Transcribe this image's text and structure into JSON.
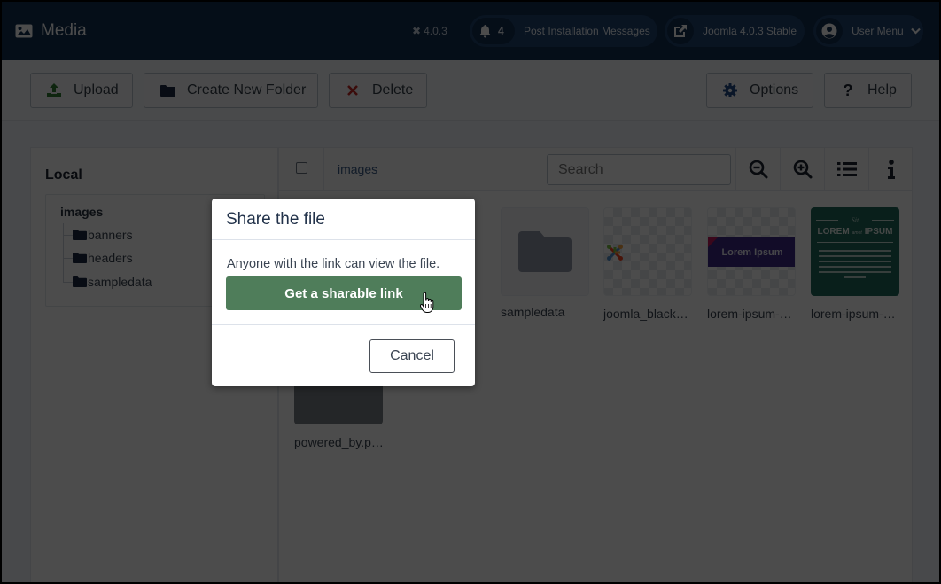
{
  "header": {
    "title": "Media",
    "version": "4.0.3",
    "notifications": {
      "count": "4",
      "label": "Post Installation Messages"
    },
    "site_link": "Joomla 4.0.3 Stable",
    "user_menu": "User Menu"
  },
  "toolbar": {
    "upload": "Upload",
    "create_folder": "Create New Folder",
    "delete": "Delete",
    "options": "Options",
    "help": "Help"
  },
  "sidebar": {
    "heading": "Local",
    "root": "images",
    "folders": [
      "banners",
      "headers",
      "sampledata"
    ]
  },
  "browser": {
    "breadcrumb": "images",
    "search_placeholder": "Search",
    "items": [
      {
        "name": "sampledata",
        "type": "folder"
      },
      {
        "name": "joomla_black…",
        "type": "image"
      },
      {
        "name": "lorem-ipsum-…",
        "type": "image"
      },
      {
        "name": "lorem-ipsum-…",
        "type": "image"
      },
      {
        "name": "powered_by.p…",
        "type": "image"
      }
    ],
    "thumb_text": {
      "banner": "Lorem Ipsum",
      "poster_small": "Sit",
      "poster_left": "LOREM",
      "poster_mid": "amet",
      "poster_right": "IPSUM"
    }
  },
  "modal": {
    "title": "Share the file",
    "description": "Anyone with the link can view the file.",
    "share_button": "Get a sharable link",
    "cancel_button": "Cancel"
  },
  "colors": {
    "header_bg": "#132f53",
    "share_button": "#4f7d5a",
    "delete_icon": "#c52827",
    "upload_icon": "#2f7d32"
  }
}
